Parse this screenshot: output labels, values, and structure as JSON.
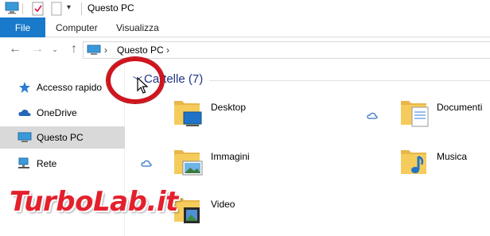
{
  "window": {
    "title": "Questo PC"
  },
  "ribbon": {
    "tabs": [
      "File",
      "Computer",
      "Visualizza"
    ]
  },
  "address": {
    "path": "Questo PC"
  },
  "sidebar": {
    "items": [
      {
        "label": "Accesso rapido",
        "icon": "star-icon"
      },
      {
        "label": "OneDrive",
        "icon": "cloud-icon"
      },
      {
        "label": "Questo PC",
        "icon": "computer-icon",
        "selected": true
      },
      {
        "label": "Rete",
        "icon": "network-icon"
      }
    ]
  },
  "content": {
    "group_header": "Cartelle (7)",
    "folders": [
      {
        "label": "Desktop",
        "icon": "desktop-folder-icon"
      },
      {
        "label": "Documenti",
        "icon": "documents-folder-icon",
        "cloud": true
      },
      {
        "label": "Immagini",
        "icon": "pictures-folder-icon",
        "cloud": true
      },
      {
        "label": "Musica",
        "icon": "music-folder-icon"
      },
      {
        "label": "Video",
        "icon": "videos-folder-icon"
      }
    ]
  },
  "watermark": {
    "text": "TurboLab.it"
  },
  "colors": {
    "accent": "#1979ca",
    "header": "#1e3287",
    "annotation": "#d0141e",
    "selected": "#d9d9d9"
  }
}
